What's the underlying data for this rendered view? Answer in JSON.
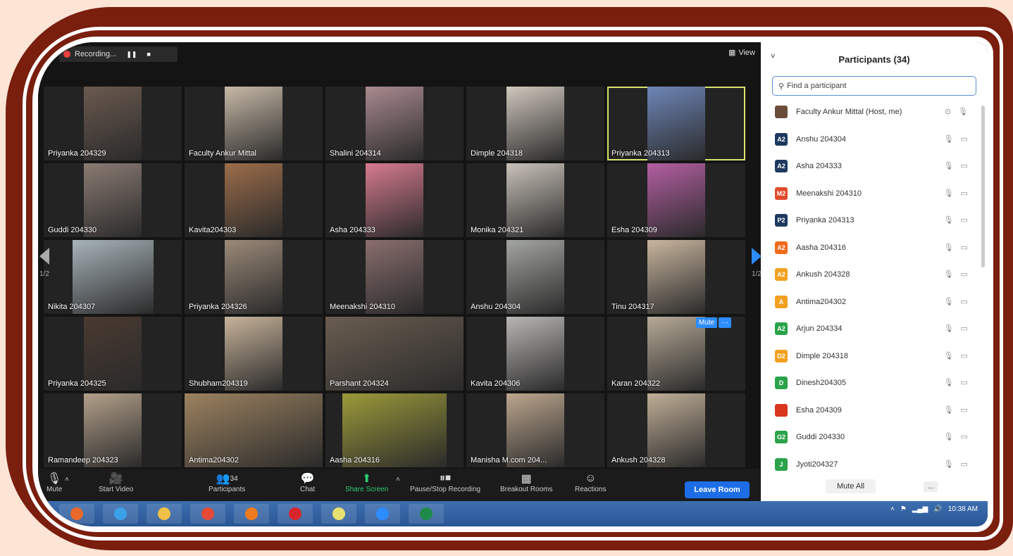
{
  "recording": {
    "label": "Recording...",
    "pause_icon": "pause-icon",
    "stop_icon": "stop-icon"
  },
  "view": {
    "label": "View"
  },
  "pager": {
    "left": "1/2",
    "right": "1/2"
  },
  "tiles": [
    {
      "name": "Priyanka 204329",
      "color": "#6b5a4f"
    },
    {
      "name": "Faculty Ankur Mittal",
      "color": "#c7b9a7"
    },
    {
      "name": "Shalini 204314",
      "color": "#a98a8f"
    },
    {
      "name": "Dimple 204318",
      "color": "#d0c7bd"
    },
    {
      "name": "Priyanka 204313",
      "color": "#6e86b7"
    },
    {
      "name": "Guddi 204330",
      "color": "#8b7b73"
    },
    {
      "name": "Kavita204303",
      "color": "#9c6d4a"
    },
    {
      "name": "Asha 204333",
      "color": "#d77b8f"
    },
    {
      "name": "Monika 204321",
      "color": "#c9c2b9"
    },
    {
      "name": "Esha 204309",
      "color": "#b45fa2"
    },
    {
      "name": "Nikita 204307",
      "color": "#a8b4ba"
    },
    {
      "name": "Priyanka 204326",
      "color": "#9c8a79"
    },
    {
      "name": "Meenakshi 204310",
      "color": "#8a6e6e"
    },
    {
      "name": "Anshu 204304",
      "color": "#a4a6a1"
    },
    {
      "name": "Tinu 204317",
      "color": "#c9b69f"
    },
    {
      "name": "Priyanka 204325",
      "color": "#4a3a31"
    },
    {
      "name": "Shubham204319",
      "color": "#c7b39a"
    },
    {
      "name": "Parshant 204324",
      "color": "#6a5d50"
    },
    {
      "name": "Kavita 204306",
      "color": "#b9b6b4"
    },
    {
      "name": "Karan 204322",
      "color": "#b7aa97"
    },
    {
      "name": "Ramandeep 204323",
      "color": "#b3a08a"
    },
    {
      "name": "Antima204302",
      "color": "#9c8260"
    },
    {
      "name": "Aasha 204316",
      "color": "#9c9a3a"
    },
    {
      "name": "Manisha M.com 204...",
      "color": "#bca68e"
    },
    {
      "name": "Ankush 204328",
      "color": "#c0ae97"
    }
  ],
  "mute_popup": {
    "mute": "Mute",
    "more": "···"
  },
  "toolbar": {
    "mute": "Mute",
    "start_video": "Start Video",
    "participants": "Participants",
    "participants_count": "34",
    "chat": "Chat",
    "share_screen": "Share Screen",
    "recording": "Pause/Stop Recording",
    "breakout": "Breakout Rooms",
    "reactions": "Reactions",
    "leave": "Leave Room"
  },
  "panel": {
    "title": "Participants (34)",
    "search_placeholder": "Find a participant",
    "host": "Faculty Ankur Mittal (Host, me)",
    "participants": [
      {
        "initials": "A2",
        "name": "Anshu 204304",
        "color": "#1e3a5f"
      },
      {
        "initials": "A2",
        "name": "Asha 204333",
        "color": "#1e3a5f"
      },
      {
        "initials": "M2",
        "name": "Meenakshi 204310",
        "color": "#e04a2a"
      },
      {
        "initials": "P2",
        "name": "Priyanka 204313",
        "color": "#1e3a5f"
      },
      {
        "initials": "A2",
        "name": "Aasha 204316",
        "color": "#ef6a1a"
      },
      {
        "initials": "A2",
        "name": "Ankush 204328",
        "color": "#f2a01f"
      },
      {
        "initials": "A",
        "name": "Antima204302",
        "color": "#f2a01f"
      },
      {
        "initials": "A2",
        "name": "Arjun 204334",
        "color": "#2aa34a"
      },
      {
        "initials": "D2",
        "name": "Dimple  204318",
        "color": "#f2a01f"
      },
      {
        "initials": "D",
        "name": "Dinesh204305",
        "color": "#2aa34a"
      },
      {
        "initials": "",
        "name": "Esha 204309",
        "color": "#d9361e"
      },
      {
        "initials": "G2",
        "name": "Guddi 204330",
        "color": "#2aa34a"
      },
      {
        "initials": "J",
        "name": "Jyoti204327",
        "color": "#2aa34a"
      }
    ],
    "mute_all": "Mute All",
    "more": "..."
  },
  "taskbar": {
    "time": "10:38 AM",
    "apps": [
      {
        "icon": "media-center-icon",
        "color": "#e8692a"
      },
      {
        "icon": "ie-icon",
        "color": "#3aa0e8"
      },
      {
        "icon": "folder-icon",
        "color": "#f0c048"
      },
      {
        "icon": "chrome-icon",
        "color": "#e64a36"
      },
      {
        "icon": "firefox-icon",
        "color": "#f07a20"
      },
      {
        "icon": "opera-icon",
        "color": "#d8242a"
      },
      {
        "icon": "sticky-notes-icon",
        "color": "#e8e070"
      },
      {
        "icon": "zoom-icon",
        "color": "#2d8cff"
      },
      {
        "icon": "excel-icon",
        "color": "#1f8a4a"
      }
    ]
  }
}
